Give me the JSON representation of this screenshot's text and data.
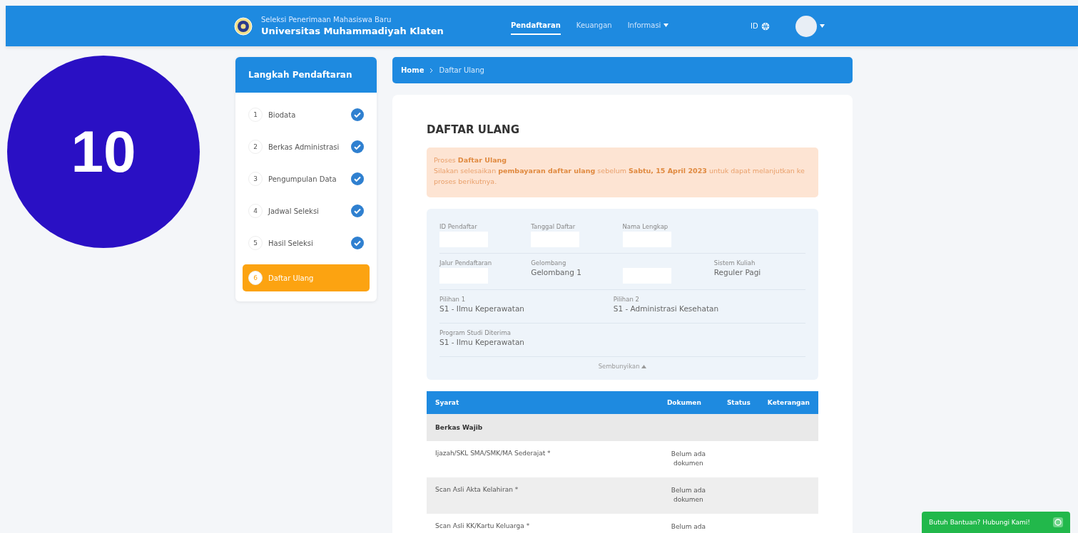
{
  "header": {
    "subtitle": "Seleksi Penerimaan Mahasiswa Baru",
    "title": "Universitas Muhammadiyah Klaten",
    "nav": [
      {
        "label": "Pendaftaran",
        "selected": true,
        "dropdown": false
      },
      {
        "label": "Keuangan",
        "selected": false,
        "dropdown": false
      },
      {
        "label": "Informasi",
        "selected": false,
        "dropdown": true
      }
    ],
    "language": "ID"
  },
  "step_badge": "10",
  "sidebar": {
    "title": "Langkah Pendaftaran",
    "steps": [
      {
        "number": "1",
        "label": "Biodata",
        "done": true,
        "selected": false
      },
      {
        "number": "2",
        "label": "Berkas Administrasi",
        "done": true,
        "selected": false
      },
      {
        "number": "3",
        "label": "Pengumpulan Data",
        "done": true,
        "selected": false
      },
      {
        "number": "4",
        "label": "Jadwal Seleksi",
        "done": true,
        "selected": false
      },
      {
        "number": "5",
        "label": "Hasil Seleksi",
        "done": true,
        "selected": false
      },
      {
        "number": "6",
        "label": "Daftar Ulang",
        "done": false,
        "selected": true
      }
    ]
  },
  "breadcrumb": [
    "Home",
    "Daftar Ulang"
  ],
  "page_title": "DAFTAR ULANG",
  "alert": {
    "title": "Proses **Daftar Ulang**",
    "message": "Silakan selesaikan **pembayaran daftar ulang** sebelum **Sabtu, 15 April 2023** untuk dapat melanjutkan ke proses berikutnya."
  },
  "info": {
    "rows": [
      [
        {
          "label": "ID Pendaftar",
          "redacted": true
        },
        {
          "label": "Tanggal Daftar",
          "redacted": true
        },
        {
          "label": "Nama Lengkap",
          "redacted": true
        }
      ],
      [
        {
          "label": "Jalur Pendaftaran",
          "redacted": true
        },
        {
          "label": "Gelombang",
          "value": "Gelombang 1",
          "redacted": false
        },
        {
          "redacted": true
        },
        {
          "label": "Sistem Kuliah",
          "value": "Reguler Pagi",
          "redacted": false
        }
      ],
      [
        {
          "label": "Pilihan 1",
          "value": "S1 - Ilmu Keperawatan",
          "redacted": false
        },
        null,
        {
          "label": "Pilihan 2",
          "value": "S1 - Administrasi Kesehatan",
          "redacted": false
        }
      ],
      [
        {
          "label": "Program Studi Diterima",
          "value": "S1 - Ilmu Keperawatan",
          "redacted": false
        }
      ]
    ],
    "toggle": "Sembunyikan"
  },
  "table": {
    "columns": [
      "Syarat",
      "Dokumen",
      "Status",
      "Keterangan"
    ],
    "rows": [
      {
        "kind": "group",
        "label": "Berkas Wajib"
      },
      {
        "kind": "item",
        "label": "Ijazah/SKL SMA/SMK/MA Sederajat *",
        "document": "Belum ada dokumen"
      },
      {
        "kind": "item",
        "label": "Scan Asli Akta Kelahiran *",
        "document": "Belum ada dokumen"
      },
      {
        "kind": "item",
        "label": "Scan Asli KK/Kartu Keluarga *",
        "document": "Belum ada"
      }
    ]
  },
  "help_button": "Butuh Bantuan? Hubungi Kami!"
}
